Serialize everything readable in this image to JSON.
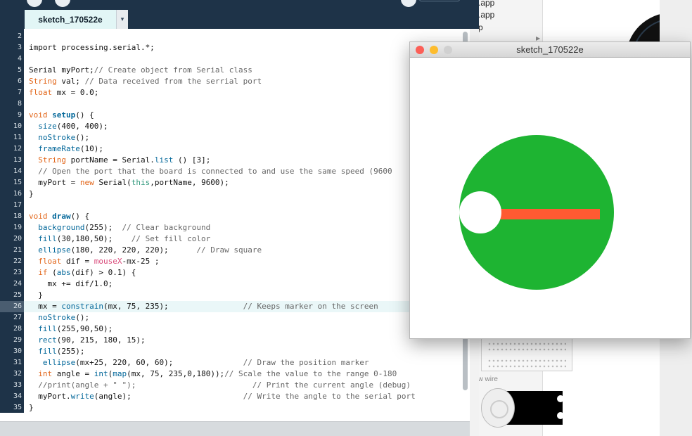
{
  "background_app": {
    "files": [
      ".app",
      ".app",
      "p"
    ],
    "wire_label": "ow wire"
  },
  "ide": {
    "tab_label": "sketch_170522e",
    "tab_menu_glyph": "▾",
    "current_line": 26,
    "lines": [
      {
        "n": "2",
        "tokens": []
      },
      {
        "n": "3",
        "tokens": [
          {
            "t": "import processing.serial.*;"
          }
        ]
      },
      {
        "n": "4",
        "tokens": []
      },
      {
        "n": "5",
        "tokens": [
          {
            "t": "Serial myPort;"
          },
          {
            "t": "// Create object from Serial class",
            "c": "cm"
          }
        ]
      },
      {
        "n": "6",
        "tokens": [
          {
            "t": "String",
            "c": "kw"
          },
          {
            "t": " val; "
          },
          {
            "t": "// Data received from the serrial port",
            "c": "cm"
          }
        ]
      },
      {
        "n": "7",
        "tokens": [
          {
            "t": "float",
            "c": "kw"
          },
          {
            "t": " mx = 0.0;"
          }
        ]
      },
      {
        "n": "8",
        "tokens": []
      },
      {
        "n": "9",
        "tokens": [
          {
            "t": "void",
            "c": "kw"
          },
          {
            "t": " "
          },
          {
            "t": "setup",
            "c": "fnb"
          },
          {
            "t": "() {"
          }
        ]
      },
      {
        "n": "10",
        "tokens": [
          {
            "t": "  "
          },
          {
            "t": "size",
            "c": "fn"
          },
          {
            "t": "(400, 400);"
          }
        ]
      },
      {
        "n": "11",
        "tokens": [
          {
            "t": "  "
          },
          {
            "t": "noStroke",
            "c": "fn"
          },
          {
            "t": "();"
          }
        ]
      },
      {
        "n": "12",
        "tokens": [
          {
            "t": "  "
          },
          {
            "t": "frameRate",
            "c": "fn"
          },
          {
            "t": "(10);"
          }
        ]
      },
      {
        "n": "13",
        "tokens": [
          {
            "t": "  "
          },
          {
            "t": "String",
            "c": "kw"
          },
          {
            "t": " portName = Serial."
          },
          {
            "t": "list",
            "c": "fn"
          },
          {
            "t": " () [3];"
          }
        ]
      },
      {
        "n": "14",
        "tokens": [
          {
            "t": "  "
          },
          {
            "t": "// Open the port that the board is connected to and use the same speed (9600",
            "c": "cm"
          }
        ]
      },
      {
        "n": "15",
        "tokens": [
          {
            "t": "  myPort = "
          },
          {
            "t": "new",
            "c": "kw"
          },
          {
            "t": " Serial("
          },
          {
            "t": "this",
            "c": "tv"
          },
          {
            "t": ",portName, 9600);"
          }
        ]
      },
      {
        "n": "16",
        "tokens": [
          {
            "t": "}"
          }
        ]
      },
      {
        "n": "17",
        "tokens": []
      },
      {
        "n": "18",
        "tokens": [
          {
            "t": "void",
            "c": "kw"
          },
          {
            "t": " "
          },
          {
            "t": "draw",
            "c": "fnb"
          },
          {
            "t": "() {"
          }
        ]
      },
      {
        "n": "19",
        "tokens": [
          {
            "t": "  "
          },
          {
            "t": "background",
            "c": "fn"
          },
          {
            "t": "(255);  "
          },
          {
            "t": "// Clear background",
            "c": "cm"
          }
        ]
      },
      {
        "n": "20",
        "tokens": [
          {
            "t": "  "
          },
          {
            "t": "fill",
            "c": "fn"
          },
          {
            "t": "(30,180,50);    "
          },
          {
            "t": "// Set fill color",
            "c": "cm"
          }
        ]
      },
      {
        "n": "21",
        "tokens": [
          {
            "t": "  "
          },
          {
            "t": "ellipse",
            "c": "fn"
          },
          {
            "t": "(180, 220, 220, 220);      "
          },
          {
            "t": "// Draw square",
            "c": "cm"
          }
        ]
      },
      {
        "n": "22",
        "tokens": [
          {
            "t": "  "
          },
          {
            "t": "float",
            "c": "kw"
          },
          {
            "t": " dif = "
          },
          {
            "t": "mouseX",
            "c": "sv"
          },
          {
            "t": "-mx-25 ;"
          }
        ]
      },
      {
        "n": "23",
        "tokens": [
          {
            "t": "  "
          },
          {
            "t": "if",
            "c": "kw"
          },
          {
            "t": " ("
          },
          {
            "t": "abs",
            "c": "fn"
          },
          {
            "t": "(dif) > 0.1) {"
          }
        ]
      },
      {
        "n": "24",
        "tokens": [
          {
            "t": "    mx += dif/1.0;"
          }
        ]
      },
      {
        "n": "25",
        "tokens": [
          {
            "t": "  }"
          }
        ]
      },
      {
        "n": "26",
        "tokens": [
          {
            "t": "  mx = "
          },
          {
            "t": "constrain",
            "c": "fn"
          },
          {
            "t": "(mx, 75, 235);                "
          },
          {
            "t": "// Keeps marker on the screen",
            "c": "cm"
          }
        ]
      },
      {
        "n": "27",
        "tokens": [
          {
            "t": "  "
          },
          {
            "t": "noStroke",
            "c": "fn"
          },
          {
            "t": "();"
          }
        ]
      },
      {
        "n": "28",
        "tokens": [
          {
            "t": "  "
          },
          {
            "t": "fill",
            "c": "fn"
          },
          {
            "t": "(255,90,50);"
          }
        ]
      },
      {
        "n": "29",
        "tokens": [
          {
            "t": "  "
          },
          {
            "t": "rect",
            "c": "fn"
          },
          {
            "t": "(90, 215, 180, 15);"
          }
        ]
      },
      {
        "n": "30",
        "tokens": [
          {
            "t": "  "
          },
          {
            "t": "fill",
            "c": "fn"
          },
          {
            "t": "(255);"
          }
        ]
      },
      {
        "n": "31",
        "tokens": [
          {
            "t": "   "
          },
          {
            "t": "ellipse",
            "c": "fn"
          },
          {
            "t": "(mx+25, 220, 60, 60);               "
          },
          {
            "t": "// Draw the position marker",
            "c": "cm"
          }
        ]
      },
      {
        "n": "32",
        "tokens": [
          {
            "t": "  "
          },
          {
            "t": "int",
            "c": "kw"
          },
          {
            "t": " angle = "
          },
          {
            "t": "int",
            "c": "fn"
          },
          {
            "t": "("
          },
          {
            "t": "map",
            "c": "fn"
          },
          {
            "t": "(mx, 75, 235,0,180));"
          },
          {
            "t": "// Scale the value to the range 0-180",
            "c": "cm"
          }
        ]
      },
      {
        "n": "33",
        "tokens": [
          {
            "t": "  "
          },
          {
            "t": "//print(angle + \" \");                         // Print the current angle (debug)",
            "c": "cm"
          }
        ]
      },
      {
        "n": "34",
        "tokens": [
          {
            "t": "  myPort."
          },
          {
            "t": "write",
            "c": "fn"
          },
          {
            "t": "(angle);                        "
          },
          {
            "t": "// Write the angle to the serial port",
            "c": "cm"
          }
        ]
      },
      {
        "n": "35",
        "tokens": [
          {
            "t": "}"
          }
        ]
      }
    ]
  },
  "sketch_window": {
    "title": "sketch_170522e",
    "fill_color": "#1eb432",
    "marker_bar_color": "#ff5a32",
    "marker_color": "#ffffff",
    "traffic_colors": {
      "close": "#fc5f57",
      "minimize": "#fdbc2e",
      "zoom": "#d0d0d0"
    }
  }
}
